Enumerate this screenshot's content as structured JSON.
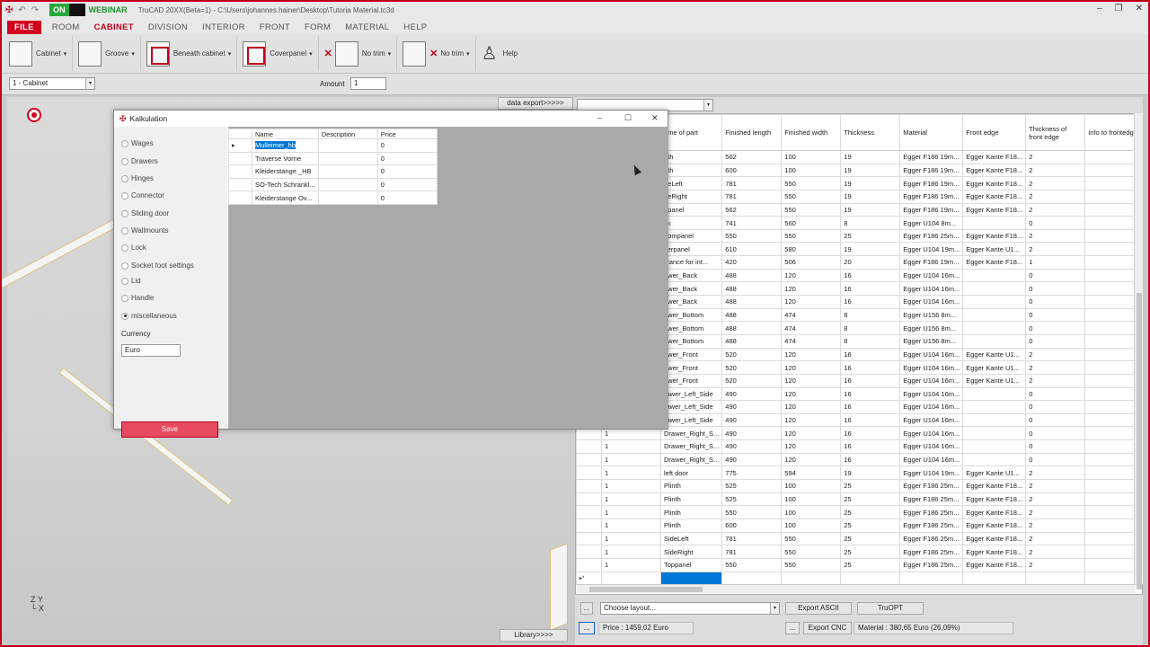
{
  "titlebar": {
    "on_badge": "ON",
    "webinar": "WEBINAR",
    "title": "TruCAD 20XX(Beta=1)  -  C:\\Users\\johannes.hainer\\Desktop\\Tutoria Material.tc3d",
    "min": "–",
    "max": "❐",
    "close": "✕"
  },
  "menu": {
    "file": "FILE",
    "items": [
      "ROOM",
      "CABINET",
      "DIVISION",
      "INTERIOR",
      "FRONT",
      "FORM",
      "MATERIAL",
      "HELP"
    ],
    "active": "CABINET"
  },
  "toolbar": {
    "cabinet": "Cabinet",
    "groove": "Groove",
    "beneath": "Beneath cabinet",
    "coverpanel": "Coverpanel",
    "notrim1": "No trim",
    "notrim2": "No trim",
    "help": "Help"
  },
  "row2": {
    "cabinet_select": "1 - Cabinet",
    "amount_label": "Amount",
    "amount_value": "1"
  },
  "buttons": {
    "data_export": "data export>>>>>",
    "library": "Library>>>>"
  },
  "dialog": {
    "title": "Kalkulation",
    "radios": [
      "Wages",
      "Drawers",
      "Hinges",
      "Connector",
      "Sliding door",
      "Wallmounts",
      "Lock",
      "Socket foot settings",
      "Lid",
      "Handle",
      "miscellaneous"
    ],
    "selected": "miscellaneous",
    "currency_label": "Currency",
    "currency_value": "Euro",
    "save": "Save",
    "columns": [
      "Name",
      "Description",
      "Price"
    ],
    "rows": [
      {
        "name": "Mulleimer_hb",
        "desc": "",
        "price": "0"
      },
      {
        "name": "Traverse Vorne",
        "desc": "",
        "price": "0"
      },
      {
        "name": "Kleiderstange _HB",
        "desc": "",
        "price": "0"
      },
      {
        "name": "SO-Tech Schrankl...",
        "desc": "",
        "price": "0"
      },
      {
        "name": "Kleiderstange Ov...",
        "desc": "",
        "price": "0"
      }
    ]
  },
  "parts": {
    "columns": [
      "",
      "ame of part",
      "Finished length",
      "Finished width",
      "Thickness",
      "Material",
      "Front edge",
      "Thickness of front edge",
      "Info to frontedge"
    ],
    "rows": [
      [
        "",
        "nth",
        "562",
        "100",
        "19",
        "Egger F186 19m...",
        "Egger Kante F18...",
        "2",
        ""
      ],
      [
        "",
        "nth",
        "600",
        "100",
        "19",
        "Egger F186 19m...",
        "Egger Kante F18...",
        "2",
        ""
      ],
      [
        "",
        "deLeft",
        "781",
        "550",
        "19",
        "Egger F186 19m...",
        "Egger Kante F18...",
        "2",
        ""
      ],
      [
        "",
        "deRight",
        "781",
        "550",
        "19",
        "Egger F186 19m...",
        "Egger Kante F18...",
        "2",
        ""
      ],
      [
        "",
        "ppanel",
        "562",
        "550",
        "19",
        "Egger F186 19m...",
        "Egger Kante F18...",
        "2",
        ""
      ],
      [
        "",
        "ck",
        "741",
        "560",
        "8",
        "Egger U104 8m...",
        "",
        "0",
        ""
      ],
      [
        "",
        "ttompanel",
        "550",
        "550",
        "25",
        "Egger F186 25m...",
        "Egger Kante F18...",
        "2",
        ""
      ],
      [
        "",
        "verpanel",
        "610",
        "580",
        "19",
        "Egger U104 19m...",
        "Egger Kante U1...",
        "2",
        ""
      ],
      [
        "",
        "stance for int...",
        "420",
        "506",
        "20",
        "Egger F186 19m...",
        "Egger Kante F18...",
        "1",
        ""
      ],
      [
        "",
        "awer_Back",
        "488",
        "120",
        "16",
        "Egger U104 16m...",
        "",
        "0",
        ""
      ],
      [
        "",
        "awer_Back",
        "488",
        "120",
        "16",
        "Egger U104 16m...",
        "",
        "0",
        ""
      ],
      [
        "",
        "awer_Back",
        "488",
        "120",
        "16",
        "Egger U104 16m...",
        "",
        "0",
        ""
      ],
      [
        "",
        "awer_Bottom",
        "488",
        "474",
        "8",
        "Egger U156 8m...",
        "",
        "0",
        ""
      ],
      [
        "",
        "awer_Bottom",
        "488",
        "474",
        "8",
        "Egger U156 8m...",
        "",
        "0",
        ""
      ],
      [
        "",
        "awer_Bottom",
        "488",
        "474",
        "8",
        "Egger U156 8m...",
        "",
        "0",
        ""
      ],
      [
        "",
        "awer_Front",
        "520",
        "120",
        "16",
        "Egger U104 16m...",
        "Egger Kante U1...",
        "2",
        ""
      ],
      [
        "",
        "awer_Front",
        "520",
        "120",
        "16",
        "Egger U104 16m...",
        "Egger Kante U1...",
        "2",
        ""
      ],
      [
        "",
        "awer_Front",
        "520",
        "120",
        "16",
        "Egger U104 16m...",
        "Egger Kante U1...",
        "2",
        ""
      ],
      [
        "",
        "rawer_Left_Side",
        "490",
        "120",
        "16",
        "Egger U104 16m...",
        "",
        "0",
        ""
      ],
      [
        "",
        "rawer_Left_Side",
        "490",
        "120",
        "16",
        "Egger U104 16m...",
        "",
        "0",
        ""
      ],
      [
        "",
        "rawer_Left_Side",
        "490",
        "120",
        "16",
        "Egger U104 16m...",
        "",
        "0",
        ""
      ],
      [
        "1",
        "Drawer_Right_S...",
        "490",
        "120",
        "16",
        "Egger U104 16m...",
        "",
        "0",
        ""
      ],
      [
        "1",
        "Drawer_Right_S...",
        "490",
        "120",
        "16",
        "Egger U104 16m...",
        "",
        "0",
        ""
      ],
      [
        "1",
        "Drawer_Right_S...",
        "490",
        "120",
        "16",
        "Egger U104 16m...",
        "",
        "0",
        ""
      ],
      [
        "1",
        "left door",
        "775",
        "594",
        "19",
        "Egger U104 19m...",
        "Egger Kante U1...",
        "2",
        ""
      ],
      [
        "1",
        "Plinth",
        "525",
        "100",
        "25",
        "Egger F186 25m...",
        "Egger Kante F18...",
        "2",
        ""
      ],
      [
        "1",
        "Plinth",
        "525",
        "100",
        "25",
        "Egger F186 25m...",
        "Egger Kante F18...",
        "2",
        ""
      ],
      [
        "1",
        "Plinth",
        "550",
        "100",
        "25",
        "Egger F186 25m...",
        "Egger Kante F18...",
        "2",
        ""
      ],
      [
        "1",
        "Plinth",
        "600",
        "100",
        "25",
        "Egger F186 25m...",
        "Egger Kante F18...",
        "2",
        ""
      ],
      [
        "1",
        "SideLeft",
        "781",
        "550",
        "25",
        "Egger F186 25m...",
        "Egger Kante F18...",
        "2",
        ""
      ],
      [
        "1",
        "SideRight",
        "781",
        "550",
        "25",
        "Egger F186 25m...",
        "Egger Kante F18...",
        "2",
        ""
      ],
      [
        "1",
        "Toppanel",
        "550",
        "550",
        "25",
        "Egger F186 25m...",
        "Egger Kante F18...",
        "2",
        ""
      ]
    ]
  },
  "bottom": {
    "dots1": "...",
    "layout": "Choose layout...",
    "export_ascii": "Export ASCII",
    "truopt": "TruOPT",
    "dots2": "...",
    "price": "Price : 1459,02 Euro",
    "dots3": "...",
    "export_cnc": "Export CNC",
    "material": "Material : 380,65 Euro (26,09%)"
  }
}
